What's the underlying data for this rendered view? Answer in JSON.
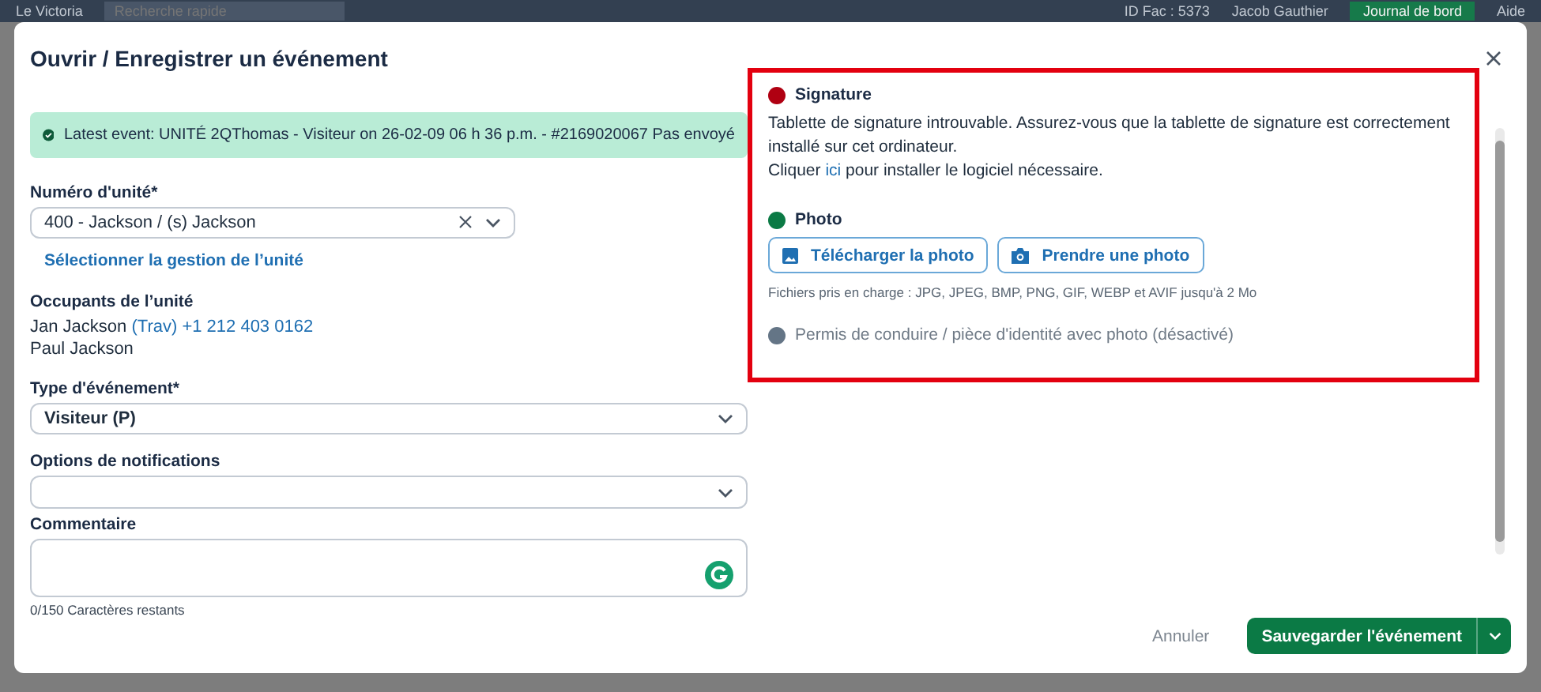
{
  "app_bar": {
    "title": "Le Victoria",
    "search": {
      "placeholder": "Recherche rapide"
    },
    "id_label": "ID Fac : 5373",
    "user": "Jacob Gauthier",
    "log_button": "Journal de bord",
    "help": "Aide"
  },
  "dialog": {
    "title": "Ouvrir / Enregistrer un événement",
    "alert": "Latest event: UNITÉ 2QThomas - Visiteur on 26-02-09 06 h 36 p.m. - #2169020067 Pas envoyé"
  },
  "unit": {
    "label": "Numéro d'unité*",
    "value": "400 - Jackson / (s) Jackson",
    "link": "Sélectionner la gestion de l’unité"
  },
  "occupants": {
    "label": "Occupants de l’unité",
    "people": [
      {
        "name": "Jan Jackson",
        "detail": "(Trav) +1 212 403 0162"
      },
      {
        "name": "Paul Jackson"
      }
    ]
  },
  "event_type": {
    "label": "Type d'événement*",
    "value": "Visiteur (P)"
  },
  "notifications": {
    "label": "Options de notifications"
  },
  "comment": {
    "label": "Commentaire",
    "counter": "0/150 Caractères restants"
  },
  "sections": [
    {
      "kind": "signature",
      "title": "Signature",
      "color": "#b00012",
      "disabled": false,
      "message": "Tablette de signature introuvable. Assurez-vous que la tablette de signature est correctement installé sur cet ordinateur.",
      "install_before": "Cliquer",
      "install_link": "ici",
      "install_after": "pour installer le logiciel nécessaire."
    },
    {
      "kind": "photo",
      "title": "Photo",
      "color": "#0b7a45",
      "disabled": false,
      "buttons": [
        {
          "kind": "upload",
          "label": "Télécharger la photo"
        },
        {
          "kind": "camera",
          "label": "Prendre une photo"
        }
      ],
      "note": "Fichiers pris en charge : JPG, JPEG, BMP, PNG, GIF, WEBP et AVIF jusqu'à 2 Mo"
    },
    {
      "kind": "id",
      "title": "Permis de conduire / pièce d'identité avec photo (désactivé)",
      "color": "#647586",
      "disabled": true
    }
  ],
  "footer": {
    "cancel": "Annuler",
    "save": "Sauvegarder l'événement"
  }
}
